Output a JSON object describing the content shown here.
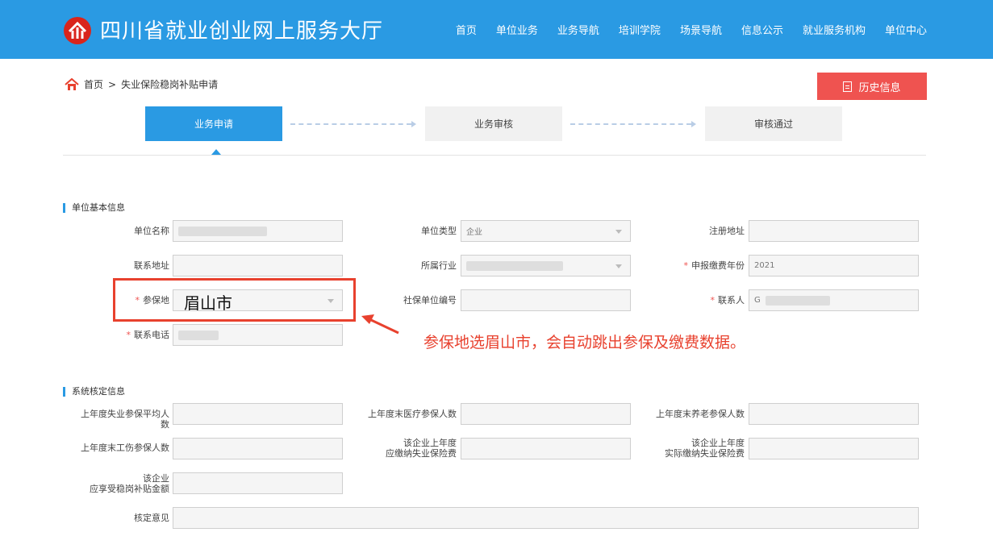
{
  "header": {
    "site_title": "四川省就业创业网上服务大厅",
    "nav": [
      "首页",
      "单位业务",
      "业务导航",
      "培训学院",
      "场景导航",
      "信息公示",
      "就业服务机构",
      "单位中心"
    ]
  },
  "breadcrumb": {
    "home": "首页",
    "separator": ">",
    "current": "失业保险稳岗补贴申请"
  },
  "history_button": "历史信息",
  "steps": [
    "业务申请",
    "业务审核",
    "审核通过"
  ],
  "sections": {
    "basic": "单位基本信息",
    "system": "系统核定信息"
  },
  "basic_fields": {
    "unit_name": {
      "label": "单位名称",
      "value": ""
    },
    "unit_type": {
      "label": "单位类型",
      "value": "企业"
    },
    "reg_address": {
      "label": "注册地址",
      "value": ""
    },
    "contact_address": {
      "label": "联系地址",
      "value": ""
    },
    "industry": {
      "label": "所属行业",
      "value": ""
    },
    "declare_year": {
      "label": "申报缴费年份",
      "value": "2021"
    },
    "insured_place": {
      "label": "参保地",
      "value": "眉山市"
    },
    "social_id": {
      "label": "社保单位编号",
      "value": ""
    },
    "contact_person": {
      "label": "联系人",
      "value": "G"
    },
    "phone": {
      "label": "联系电话",
      "value": ""
    }
  },
  "system_fields": {
    "unemp_avg": {
      "label1": "上年度失业参保平均人",
      "label2": "数"
    },
    "medical_count": {
      "label": "上年度末医疗参保人数"
    },
    "pension_count": {
      "label": "上年度末养老参保人数"
    },
    "injury_count": {
      "label": "上年度末工伤参保人数"
    },
    "due_fee": {
      "label1": "该企业上年度",
      "label2": "应缴纳失业保险费"
    },
    "paid_fee": {
      "label1": "该企业上年度",
      "label2": "实际缴纳失业保险费"
    },
    "subsidy": {
      "label1": "该企业",
      "label2": "应享受稳岗补贴金额"
    },
    "opinion": {
      "label": "核定意见"
    }
  },
  "annotation": "参保地选眉山市，会自动跳出参保及缴费数据。",
  "colors": {
    "header_blue": "#2a9ae3",
    "accent_red": "#ef5350",
    "annotation_red": "#e8412e"
  }
}
